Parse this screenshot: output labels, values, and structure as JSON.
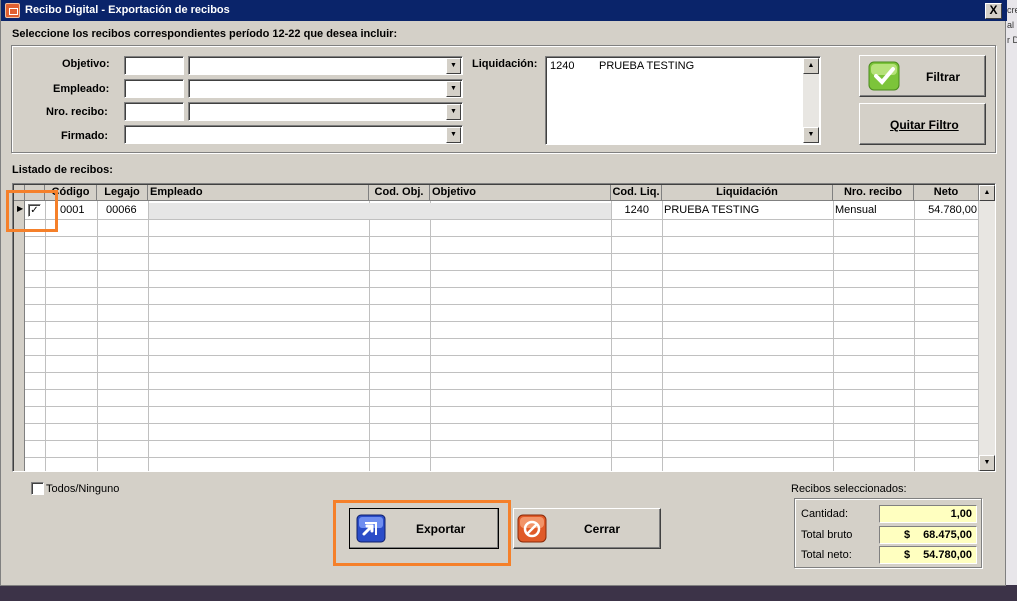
{
  "window": {
    "title": "Recibo Digital - Exportación de recibos",
    "close_label": "X"
  },
  "instruction": "Seleccione los recibos correspondientes período 12-22 que desea incluir:",
  "filters": {
    "objetivo_label": "Objetivo:",
    "empleado_label": "Empleado:",
    "nro_recibo_label": "Nro. recibo:",
    "firmado_label": "Firmado:",
    "liquidacion_label": "Liquidación:",
    "liquidacion_items": [
      {
        "code": "1240",
        "name": "PRUEBA TESTING"
      }
    ]
  },
  "buttons": {
    "filtrar": "Filtrar",
    "quitar_filtro": "Quitar Filtro",
    "exportar": "Exportar",
    "cerrar": "Cerrar"
  },
  "list": {
    "label": "Listado de recibos:",
    "columns": [
      "Código",
      "Legajo",
      "Empleado",
      "Cod. Obj.",
      "Objetivo",
      "Cod. Liq.",
      "Liquidación",
      "Nro. recibo",
      "Neto"
    ],
    "rows": [
      {
        "checked": true,
        "codigo": "0001",
        "legajo": "00066",
        "empleado": "",
        "cod_obj": "",
        "objetivo": "",
        "cod_liq": "1240",
        "liquidacion": "PRUEBA TESTING",
        "nro_recibo": "Mensual",
        "neto": "54.780,00"
      }
    ]
  },
  "todos_ninguno_label": "Todos/Ninguno",
  "totals": {
    "label": "Recibos seleccionados:",
    "cantidad_label": "Cantidad:",
    "cantidad": "1,00",
    "bruto_label": "Total bruto",
    "bruto_currency": "$",
    "bruto": "68.475,00",
    "neto_label": "Total neto:",
    "neto_currency": "$",
    "neto": "54.780,00"
  },
  "colors": {
    "titlebar": "#0a246a",
    "highlight": "#f5802a",
    "totals_bg": "#ffffc0"
  }
}
